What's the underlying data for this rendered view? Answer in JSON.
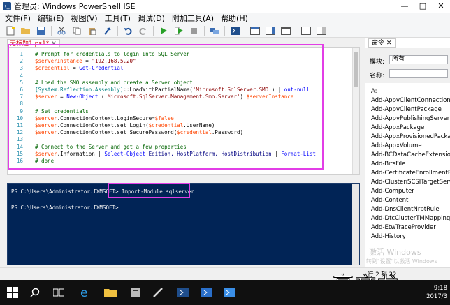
{
  "window": {
    "title": "管理员: Windows PowerShell ISE",
    "controls": [
      "—",
      "□",
      "✕"
    ]
  },
  "menu": [
    "文件(F)",
    "编辑(E)",
    "视图(V)",
    "工具(T)",
    "调试(D)",
    "附加工具(A)",
    "帮助(H)"
  ],
  "tab": {
    "name": "无标题1.ps1*",
    "close": "✕"
  },
  "code": [
    {
      "n": "1",
      "parts": [
        [
          "c-comment",
          "  # Prompt for credentials to login into SQL Server"
        ]
      ]
    },
    {
      "n": "2",
      "parts": [
        [
          "c-var",
          "  $serverInstance"
        ],
        [
          "c-plain",
          " = "
        ],
        [
          "c-str",
          "\"192.168.5.20\""
        ]
      ]
    },
    {
      "n": "3",
      "parts": [
        [
          "c-var",
          "  $credential"
        ],
        [
          "c-plain",
          " = "
        ],
        [
          "c-cmd",
          "Get-Credential"
        ]
      ]
    },
    {
      "n": "4",
      "parts": [
        [
          "c-plain",
          ""
        ]
      ]
    },
    {
      "n": "5",
      "parts": [
        [
          "c-comment",
          "  # Load the SMO assembly and create a Server object"
        ]
      ]
    },
    {
      "n": "6",
      "parts": [
        [
          "c-type",
          "  [System.Reflection.Assembly]"
        ],
        [
          "c-plain",
          "::LoadWithPartialName("
        ],
        [
          "c-str",
          "'Microsoft.SqlServer.SMO'"
        ],
        [
          "c-plain",
          ") | "
        ],
        [
          "c-cmd",
          "out-null"
        ]
      ]
    },
    {
      "n": "7",
      "parts": [
        [
          "c-var",
          "  $server"
        ],
        [
          "c-plain",
          " = "
        ],
        [
          "c-cmd",
          "New-Object"
        ],
        [
          "c-plain",
          " ("
        ],
        [
          "c-str",
          "'Microsoft.SqlServer.Management.Smo.Server'"
        ],
        [
          "c-plain",
          ") "
        ],
        [
          "c-var",
          "$serverInstance"
        ]
      ]
    },
    {
      "n": "8",
      "parts": [
        [
          "c-plain",
          ""
        ]
      ]
    },
    {
      "n": "9",
      "parts": [
        [
          "c-comment",
          "  # Set credentials"
        ]
      ]
    },
    {
      "n": "10",
      "parts": [
        [
          "c-var",
          "  $server"
        ],
        [
          "c-plain",
          ".ConnectionContext.LoginSecure="
        ],
        [
          "c-var",
          "$false"
        ]
      ]
    },
    {
      "n": "11",
      "parts": [
        [
          "c-var",
          "  $server"
        ],
        [
          "c-plain",
          ".ConnectionContext.set_Login("
        ],
        [
          "c-var",
          "$credential"
        ],
        [
          "c-plain",
          ".UserName)"
        ]
      ]
    },
    {
      "n": "12",
      "parts": [
        [
          "c-var",
          "  $server"
        ],
        [
          "c-plain",
          ".ConnectionContext.set_SecurePassword("
        ],
        [
          "c-var",
          "$credential"
        ],
        [
          "c-plain",
          ".Password)"
        ]
      ]
    },
    {
      "n": "13",
      "parts": [
        [
          "c-plain",
          ""
        ]
      ]
    },
    {
      "n": "14",
      "parts": [
        [
          "c-comment",
          "  # Connect to the Server and get a few properties"
        ]
      ]
    },
    {
      "n": "15",
      "parts": [
        [
          "c-var",
          "  $server"
        ],
        [
          "c-plain",
          ".Information | "
        ],
        [
          "c-cmd",
          "Select-Object"
        ],
        [
          "c-param",
          " Edition, HostPlatform, HostDistribution"
        ],
        [
          "c-plain",
          " | "
        ],
        [
          "c-cmd",
          "Format-List"
        ]
      ]
    },
    {
      "n": "16",
      "parts": [
        [
          "c-comment",
          "  # done"
        ]
      ]
    }
  ],
  "console": {
    "line1_prompt": "PS C:\\Users\\Administrator.IXMSOFT>",
    "line1_cmd": " Import-Module sqlserver",
    "line2_prompt": "PS C:\\Users\\Administrator.IXMSOFT>"
  },
  "commands_pane": {
    "tab": "命令",
    "close": "✕",
    "module_label": "模块:",
    "module_value": "所有",
    "name_label": "名称:",
    "items": [
      "A:",
      "Add-AppvClientConnectionG",
      "Add-AppvClientPackage",
      "Add-AppvPublishingServer",
      "Add-AppxPackage",
      "Add-AppxProvisionedPackag",
      "Add-AppxVolume",
      "Add-BCDataCacheExtension",
      "Add-BitsFile",
      "Add-CertificateEnrollmentPol",
      "Add-ClusteriSCSITargetServer",
      "Add-Computer",
      "Add-Content",
      "Add-DnsClientNrptRule",
      "Add-DtcClusterTMMapping",
      "Add-EtwTraceProvider",
      "Add-History"
    ]
  },
  "status": {
    "position": "行 2 列 32",
    "watermark1": "激活 Windows",
    "watermark2": "转到\"设置\"以激活 Windows",
    "overlay": "高文龙"
  },
  "taskbar": {
    "time": "9:18",
    "date": "2017/3"
  }
}
